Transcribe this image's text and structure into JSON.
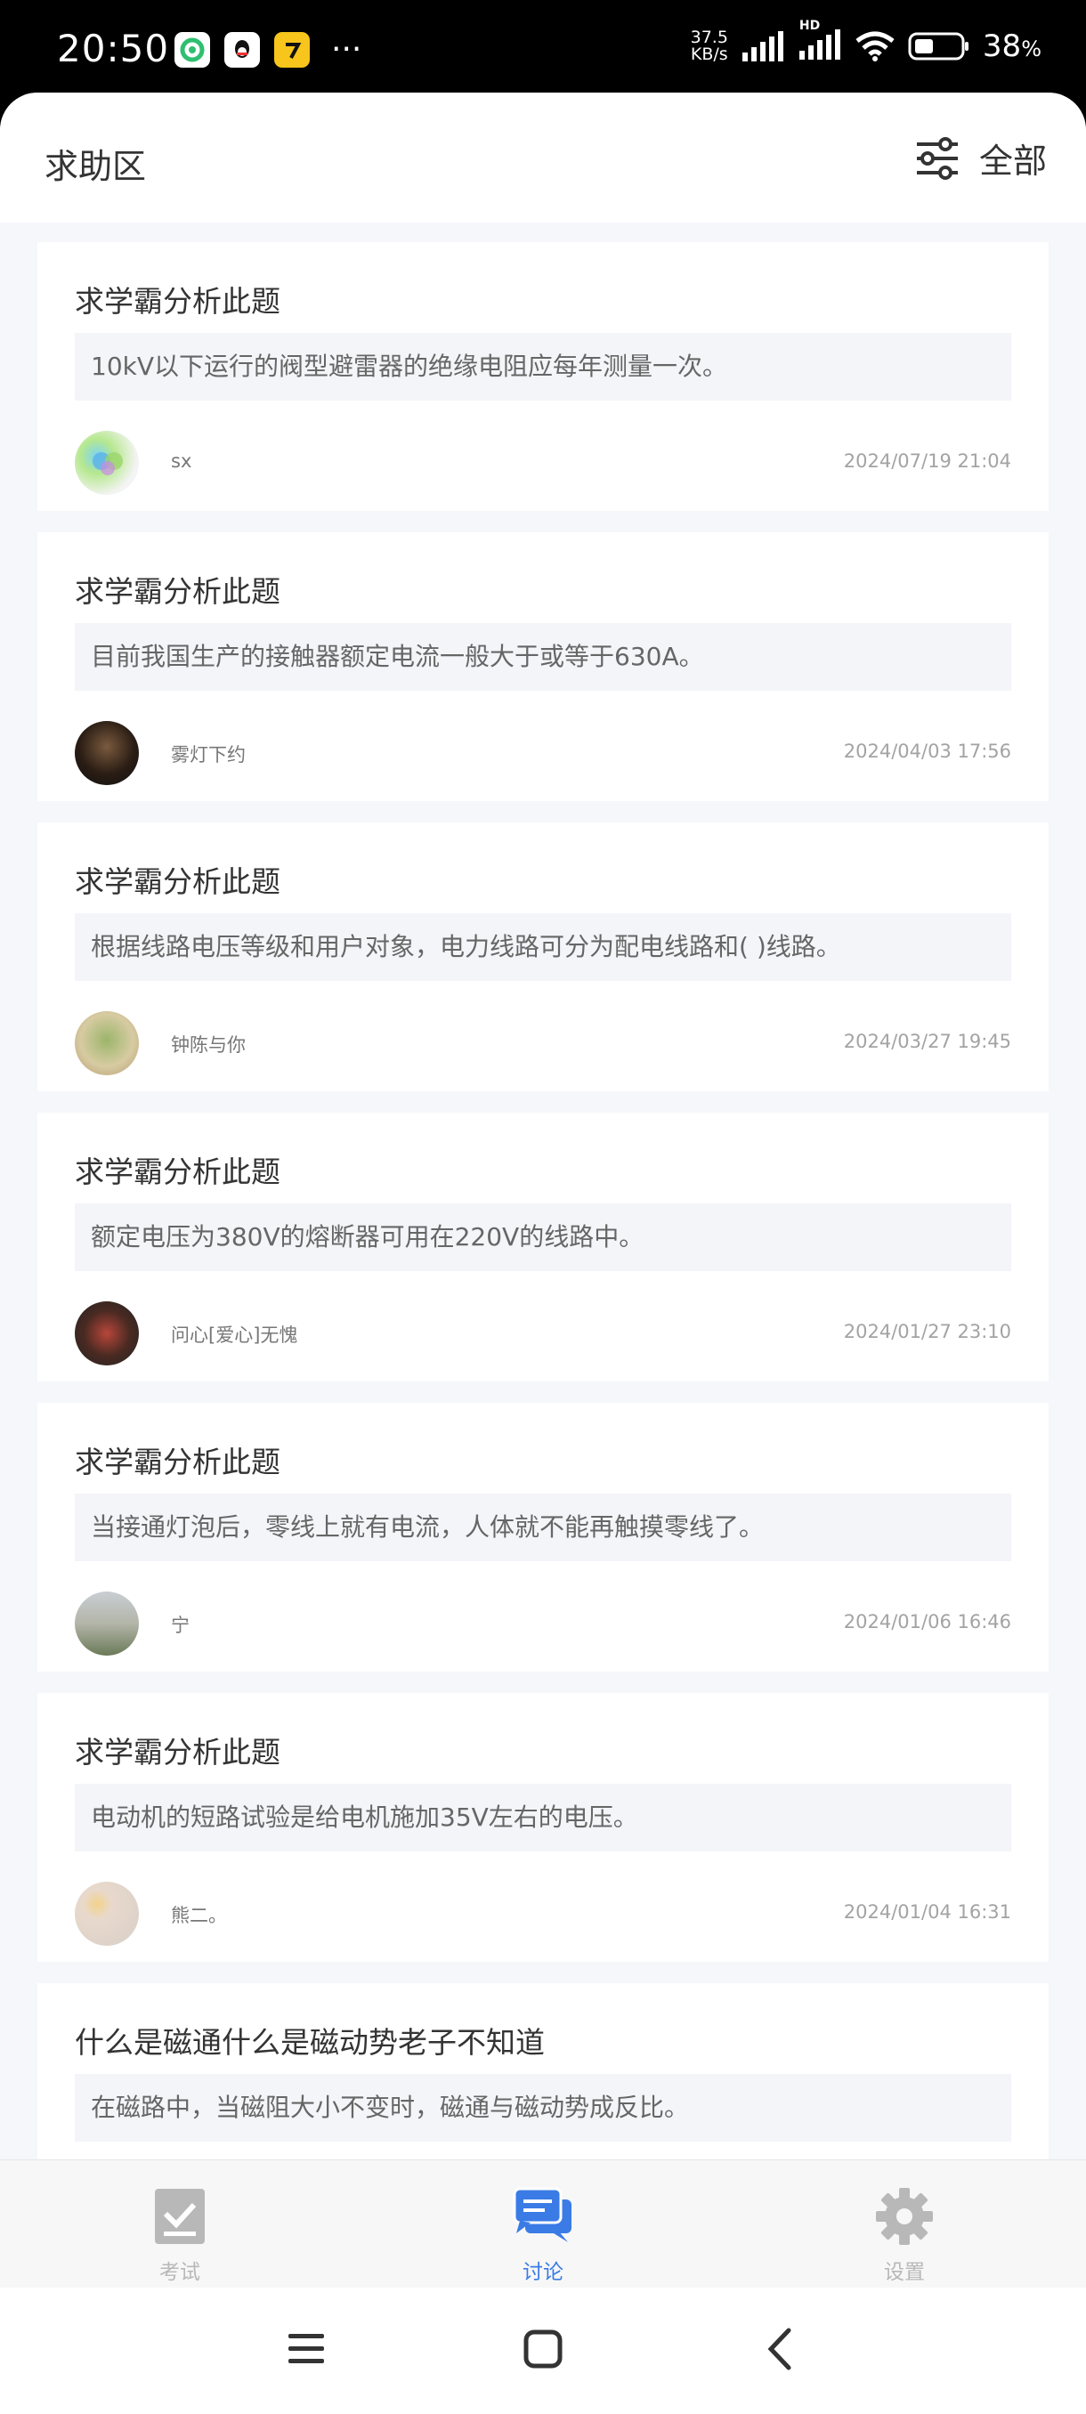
{
  "status_bar": {
    "time": "20:50",
    "net_speed_value": "37.5",
    "net_speed_unit": "KB/s",
    "signal_label": "HD",
    "battery_percent": "38",
    "battery_unit": "%",
    "more": "···"
  },
  "header": {
    "title": "求助区",
    "filter_label": "全部"
  },
  "posts": [
    {
      "title": "求学霸分析此题",
      "question": "10kV以下运行的阀型避雷器的绝缘电阻应每年测量一次。",
      "user": "sx",
      "time": "2024/07/19 21:04"
    },
    {
      "title": "求学霸分析此题",
      "question": "目前我国生产的接触器额定电流一般大于或等于630A。",
      "user": "雾灯下约",
      "time": "2024/04/03 17:56"
    },
    {
      "title": "求学霸分析此题",
      "question": "根据线路电压等级和用户对象，电力线路可分为配电线路和( )线路。",
      "user": "钟陈与你",
      "time": "2024/03/27 19:45"
    },
    {
      "title": "求学霸分析此题",
      "question": "额定电压为380V的熔断器可用在220V的线路中。",
      "user": "问心[爱心]无愧",
      "time": "2024/01/27 23:10"
    },
    {
      "title": "求学霸分析此题",
      "question": "当接通灯泡后，零线上就有电流，人体就不能再触摸零线了。",
      "user": "宁",
      "time": "2024/01/06 16:46"
    },
    {
      "title": "求学霸分析此题",
      "question": "电动机的短路试验是给电机施加35V左右的电压。",
      "user": "熊二。",
      "time": "2024/01/04 16:31"
    },
    {
      "title": "什么是磁通什么是磁动势老子不知道",
      "question": "在磁路中，当磁阻大小不变时，磁通与磁动势成反比。",
      "user": "",
      "time": ""
    }
  ],
  "tabs": {
    "exam": "考试",
    "discussion": "讨论",
    "settings": "设置"
  },
  "colors": {
    "accent": "#3a7be6",
    "tab_inactive": "#b8b8b8",
    "page_bg": "#f5f7fb"
  }
}
